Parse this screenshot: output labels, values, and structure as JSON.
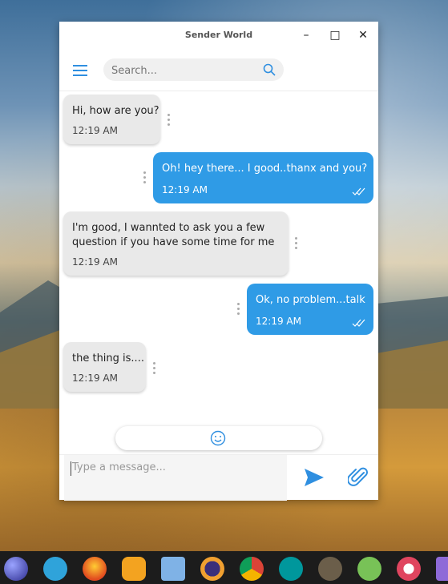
{
  "window": {
    "title": "Sender World",
    "minimize": "–",
    "maximize": "□",
    "close": "✕"
  },
  "search": {
    "placeholder": "Search..."
  },
  "messages": [
    {
      "direction": "in",
      "text": "Hi, how are you?",
      "time": "12:19 AM"
    },
    {
      "direction": "out",
      "text": "Oh! hey there... I good..thanx and you?",
      "time": "12:19 AM",
      "status": "read"
    },
    {
      "direction": "in",
      "text": "I'm good, I wannted to ask you a few\nquestion if you have some time for me",
      "time": "12:19 AM"
    },
    {
      "direction": "out",
      "text": "Ok, no problem...talk",
      "time": "12:19 AM",
      "status": "read"
    },
    {
      "direction": "in",
      "text": "the thing is....",
      "time": "12:19 AM"
    }
  ],
  "composer": {
    "placeholder": "Type a message..."
  },
  "icons": {
    "menu": "hamburger-icon",
    "search": "search-icon",
    "emoji": "smiley-icon",
    "send": "send-icon",
    "attach": "paperclip-icon"
  },
  "colors": {
    "accent": "#2f9be6",
    "incoming_bubble": "#e9e9e9"
  },
  "taskbar": {
    "apps": [
      "eclipse-icon",
      "telegram-icon",
      "firefox-icon",
      "app-icon",
      "box-icon",
      "eclipse-alt-icon",
      "chrome-icon",
      "arduino-icon",
      "gimp-icon",
      "android-studio-icon",
      "settings-icon",
      "purple-app-icon"
    ]
  }
}
